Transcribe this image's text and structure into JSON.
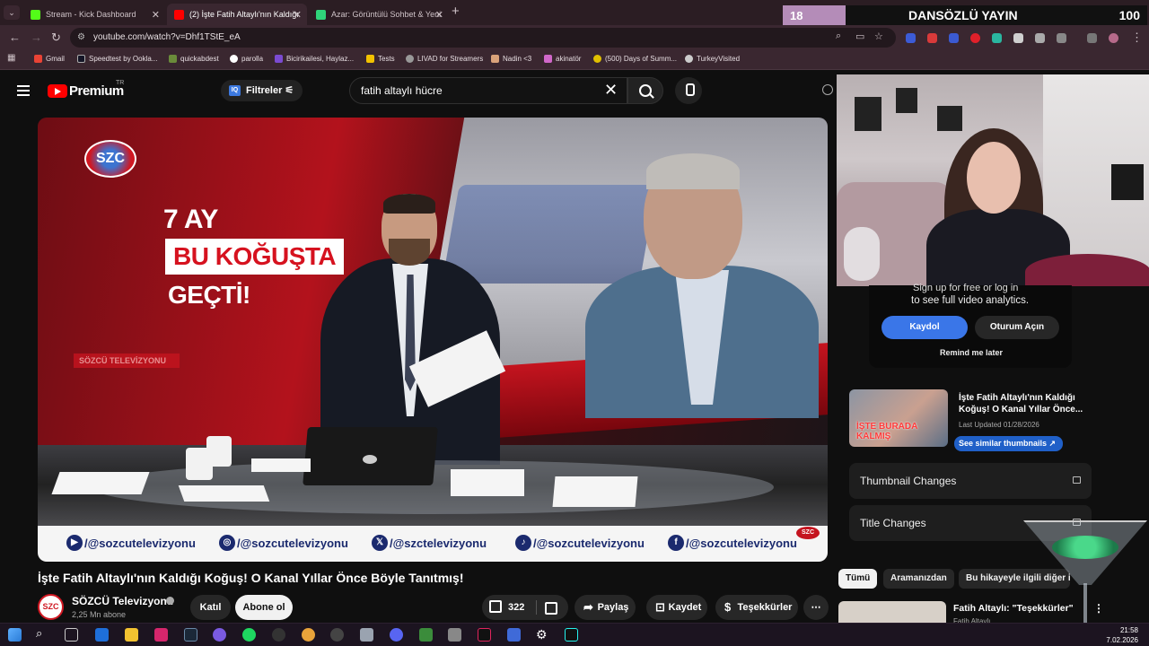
{
  "browser": {
    "tabs": [
      {
        "title": "Stream - Kick Dashboard",
        "favicon_color": "#53fc18",
        "active": false
      },
      {
        "title": "(2) İşte Fatih Altaylı'nın Kaldığı",
        "favicon_color": "#ff0000",
        "active": true
      },
      {
        "title": "Azar: Görüntülü Sohbet & Yeni",
        "favicon_color": "#2fd47a",
        "active": false
      }
    ],
    "url": "youtube.com/watch?v=Dhf1TStE_eA",
    "bookmarks": [
      {
        "label": "Gmail",
        "color": "#ea4335"
      },
      {
        "label": "Speedtest by Ookla...",
        "color": "#141526"
      },
      {
        "label": "quickabdest",
        "color": "#6a8b3a"
      },
      {
        "label": "parolla",
        "color": "#ffffff"
      },
      {
        "label": "Bicirikailesi, Haylaz...",
        "color": "#7b4bd1"
      },
      {
        "label": "Tests",
        "color": "#f2c200"
      },
      {
        "label": "LIVAD for Streamers",
        "color": "#999999"
      },
      {
        "label": "Nadin <3",
        "color": "#d9a27a"
      },
      {
        "label": "akinatör",
        "color": "#d068c9"
      },
      {
        "label": "(500) Days of Summ...",
        "color": "#e0c000"
      },
      {
        "label": "TurkeyVisited",
        "color": "#cccccc"
      }
    ]
  },
  "stream_overlay": {
    "viewer_count": "18",
    "title": "DANSÖZLÜ YAYIN",
    "goal": "100"
  },
  "youtube": {
    "brand": "Premium",
    "country_code": "TR",
    "filters_label": "Filtreler",
    "search_query": "fatih altaylı hücre",
    "video": {
      "channel_logo": "SZC",
      "headline_line1": "7 AY",
      "headline_line2": "BU KOĞUŞTA",
      "headline_line3": "GEÇTİ!",
      "strip_text": "SÖZCÜ TELEVİZYONU",
      "socials": [
        {
          "icon": "youtube-icon",
          "glyph": "▶",
          "handle": "/@sozcutelevizyonu"
        },
        {
          "icon": "instagram-icon",
          "glyph": "◎",
          "handle": "/@sozcutelevizyonu"
        },
        {
          "icon": "x-icon",
          "glyph": "𝕏",
          "handle": "/@szctelevizyonu"
        },
        {
          "icon": "tiktok-icon",
          "glyph": "♪",
          "handle": "/@sozcutelevizyonu"
        },
        {
          "icon": "facebook-icon",
          "glyph": "f",
          "handle": "/@sozcutelevizyonu"
        }
      ],
      "corner_logo": "SZC"
    },
    "title": "İşte Fatih Altaylı'nın Kaldığı Koğuş! O Kanal Yıllar Önce Böyle Tanıtmış!",
    "channel": {
      "avatar_text": "SZC",
      "name": "SÖZCÜ Televizyonu",
      "subscribers": "2,25 Mn abone"
    },
    "actions": {
      "join": "Katıl",
      "subscribe": "Abone ol",
      "likes": "322",
      "share": "Paylaş",
      "save": "Kaydet",
      "thanks": "Teşekkürler"
    }
  },
  "sidebar": {
    "analytics_cut": "Sign up for free or log in",
    "analytics_text": "to see full video analytics.",
    "signup": "Kaydol",
    "login": "Oturum Açın",
    "remind": "Remind me later",
    "thumb_overlay": "İŞTE BURADA\nKALMIŞ",
    "thumb_title": "İşte Fatih Altaylı'nın Kaldığı Koğuş! O Kanal Yıllar Önce...",
    "thumb_updated": "Last Updated 01/28/2026",
    "similar_btn": "See similar thumbnails ↗",
    "features": [
      "Thumbnail Changes",
      "Title Changes"
    ],
    "chips": [
      "Tümü",
      "Aramanızdan",
      "Bu hikayeyle ilgili diğer i"
    ],
    "rec_title": "Fatih Altaylı: \"Teşekkürler\"",
    "rec_sub": "Fatih Altaylı"
  },
  "taskbar": {
    "time": "21:58",
    "date": "7.02.2026"
  }
}
